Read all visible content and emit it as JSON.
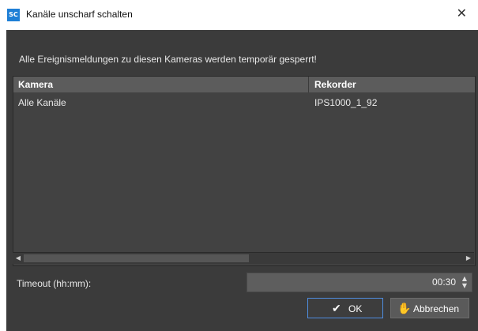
{
  "window": {
    "app_icon_text": "SC",
    "title": "Kanäle unscharf schalten"
  },
  "message": "Alle Ereignismeldungen zu diesen Kameras werden temporär gesperrt!",
  "table": {
    "columns": [
      "Kamera",
      "Rekorder"
    ],
    "rows": [
      [
        "Alle Kanäle",
        "IPS1000_1_92"
      ]
    ]
  },
  "timeout": {
    "label": "Timeout (hh:mm):",
    "value": "00:30"
  },
  "buttons": {
    "ok": "OK",
    "cancel": "Abbrechen"
  }
}
